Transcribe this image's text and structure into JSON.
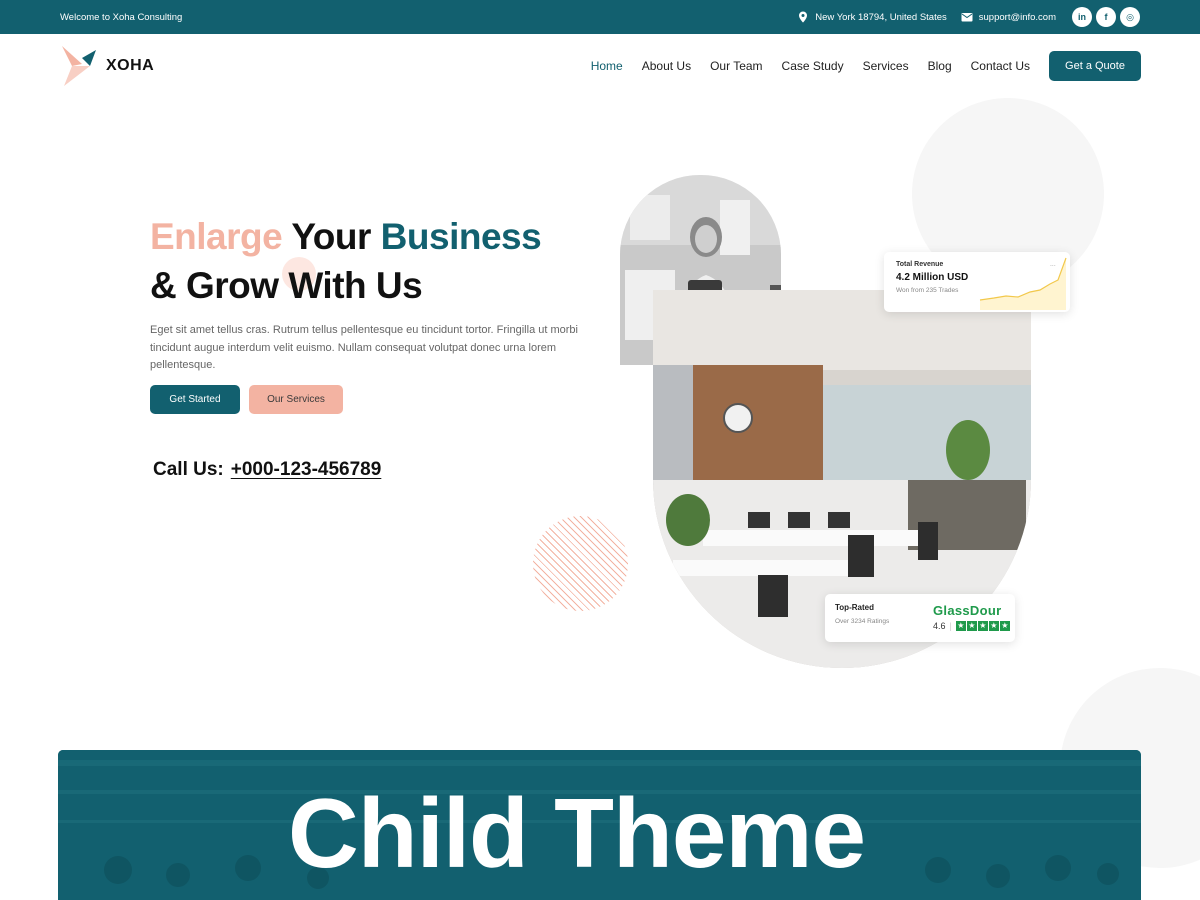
{
  "topbar": {
    "welcome": "Welcome to Xoha Consulting",
    "address": "New York 18794, United States",
    "email": "support@info.com",
    "social": [
      {
        "icon": "linkedin-icon",
        "label": "in"
      },
      {
        "icon": "facebook-icon",
        "label": "f"
      },
      {
        "icon": "instagram-icon",
        "label": "◎"
      }
    ]
  },
  "header": {
    "logo_text": "XOHA",
    "nav": [
      "Home",
      "About Us",
      "Our Team",
      "Case Study",
      "Services",
      "Blog",
      "Contact Us"
    ],
    "active_nav": "Home",
    "cta": "Get a Quote"
  },
  "hero": {
    "title_part1": "Enlarge",
    "title_part2": "Your",
    "title_part3": "Business",
    "title_line2": "& Grow With Us",
    "description": "Eget sit amet tellus cras. Rutrum tellus pellentesque eu tincidunt tortor. Fringilla ut morbi tincidunt augue interdum velit euismo. Nullam consequat volutpat donec urna lorem pellentesque.",
    "btn_primary": "Get Started",
    "btn_secondary": "Our Services",
    "call_label": "Call Us:",
    "call_number": "+000-123-456789"
  },
  "revenue_card": {
    "label": "Total Revenue",
    "value": "4.2 Million USD",
    "sub": "Won from 235 Trades"
  },
  "rating_card": {
    "label": "Top-Rated",
    "sub": "Over 3234 Ratings",
    "brand": "GlassDour",
    "score": "4.6",
    "stars": 5
  },
  "banner": {
    "text": "Child Theme"
  },
  "colors": {
    "teal": "#12606f",
    "pink": "#f3b3a2",
    "green": "#1f9a4b"
  }
}
